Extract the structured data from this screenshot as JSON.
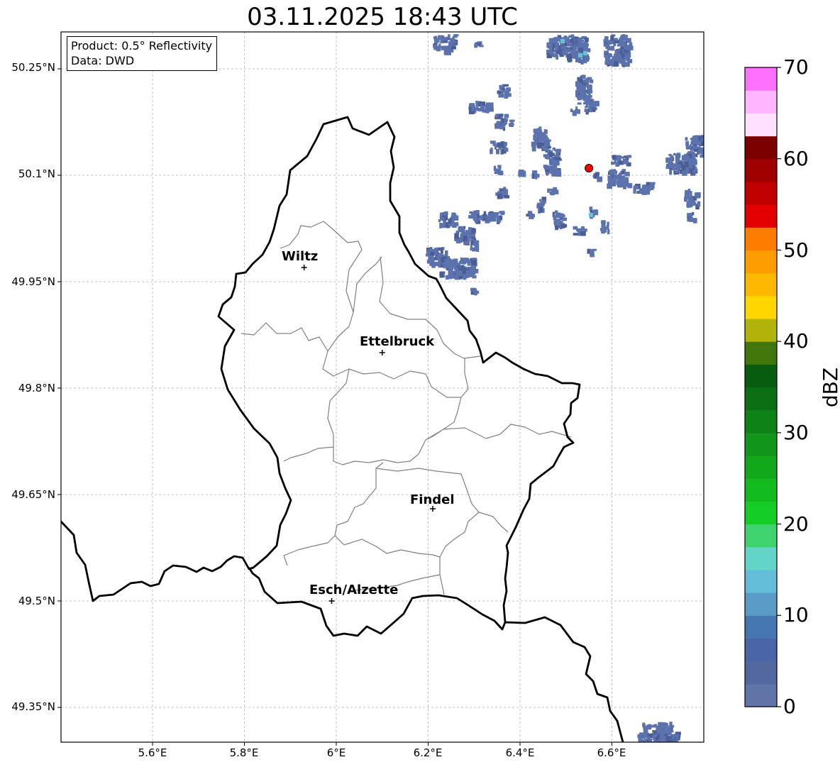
{
  "title": "03.11.2025 18:43 UTC",
  "info_box": {
    "product": "Product: 0.5° Reflectivity",
    "data": "Data: DWD"
  },
  "axes": {
    "lat_labels": [
      "50.25°N",
      "50.1°N",
      "49.95°N",
      "49.8°N",
      "49.65°N",
      "49.5°N",
      "49.35°N"
    ],
    "lon_labels": [
      "5.6°E",
      "5.8°E",
      "6°E",
      "6.2°E",
      "6.4°E",
      "6.6°E"
    ],
    "grid": true
  },
  "cities": [
    {
      "name": "Wiltz",
      "lon": 5.93,
      "lat": 49.97
    },
    {
      "name": "Ettelbruck",
      "lon": 6.1,
      "lat": 49.85
    },
    {
      "name": "Findel",
      "lon": 6.21,
      "lat": 49.63
    },
    {
      "name": "Esch/Alzette",
      "lon": 5.99,
      "lat": 49.5
    }
  ],
  "radar_site": {
    "lon": 6.55,
    "lat": 50.11,
    "color": "#ff0000"
  },
  "colorbar": {
    "label": "dBZ",
    "ticks": [
      "0",
      "10",
      "20",
      "30",
      "40",
      "50",
      "60",
      "70"
    ],
    "min": 0,
    "max": 70,
    "step": 2.5,
    "colors": [
      "#6074a8",
      "#5468a0",
      "#4a66a6",
      "#4777b3",
      "#5a9cc6",
      "#63bcd8",
      "#63d5c6",
      "#3fd36f",
      "#13cc24",
      "#12bc1f",
      "#12a81b",
      "#11951a",
      "#0e8217",
      "#0a7013",
      "#075c0f",
      "#40760b",
      "#b1b20a",
      "#ffd700",
      "#feb800",
      "#fe9d00",
      "#fe7d00",
      "#e40000",
      "#c10000",
      "#a10000",
      "#7c0000",
      "#ffe0ff",
      "#ffb6ff",
      "#ff70ff",
      "#ec34ec"
    ]
  },
  "colors": {
    "border": "#000000",
    "canton_border": "#808080",
    "grid": "#b0b0b0",
    "echo_main": "#5b72ad",
    "echo_dark": "#4a5e95",
    "echo_light": "#6bc0d6"
  }
}
